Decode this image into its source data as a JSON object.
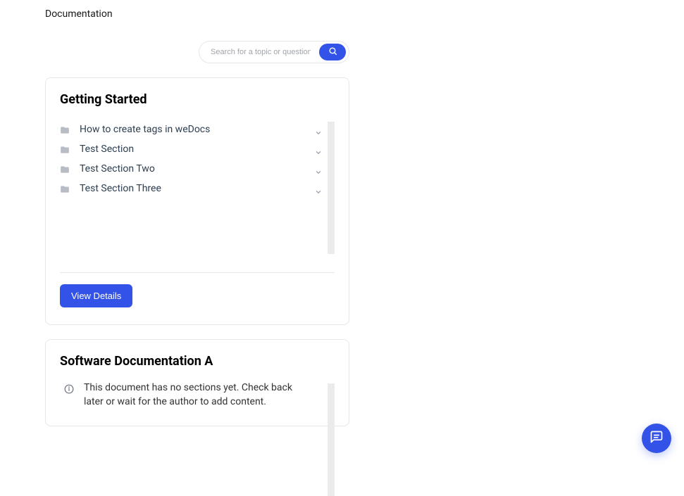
{
  "page": {
    "title": "Documentation"
  },
  "search": {
    "placeholder": "Search for a topic or question ..."
  },
  "cards": {
    "getting_started": {
      "title": "Getting Started",
      "view_details_label": "View Details",
      "sections": [
        {
          "label": "How to create tags in weDocs"
        },
        {
          "label": "Test Section"
        },
        {
          "label": "Test Section Two"
        },
        {
          "label": "Test Section Three"
        }
      ]
    },
    "software_doc_a": {
      "title": "Software Documentation A",
      "empty_message": "This document has no sections yet. Check back later or wait for the author to add content."
    }
  },
  "icons": {
    "search": "search-icon",
    "folder": "folder-icon",
    "chevron_down": "chevron-down-icon",
    "info": "info-icon",
    "chat": "chat-icon"
  }
}
